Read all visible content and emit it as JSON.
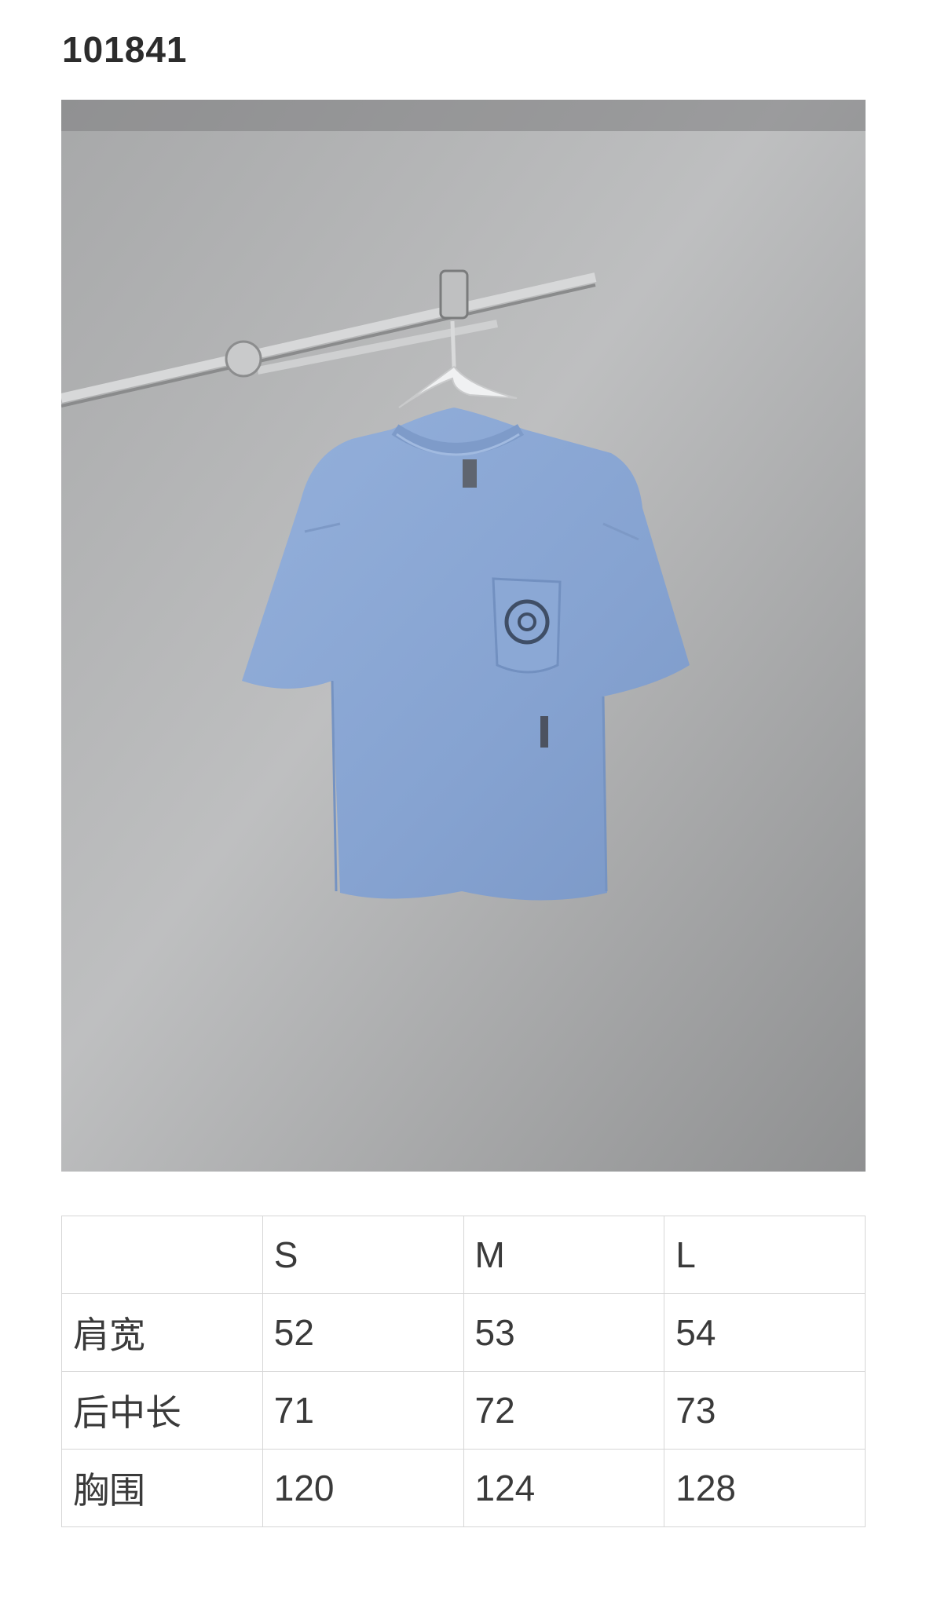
{
  "product": {
    "code": "101841"
  },
  "photo": {
    "subject": "tshirt-photo",
    "shirt_color": "#8aa7d4",
    "background_color": "#b8b9ba"
  },
  "size_table": {
    "header": [
      "",
      "S",
      "M",
      "L"
    ],
    "rows": [
      {
        "label": "肩宽",
        "values": [
          "52",
          "53",
          "54"
        ]
      },
      {
        "label": "后中长",
        "values": [
          "71",
          "72",
          "73"
        ]
      },
      {
        "label": "胸围",
        "values": [
          "120",
          "124",
          "128"
        ]
      }
    ]
  }
}
